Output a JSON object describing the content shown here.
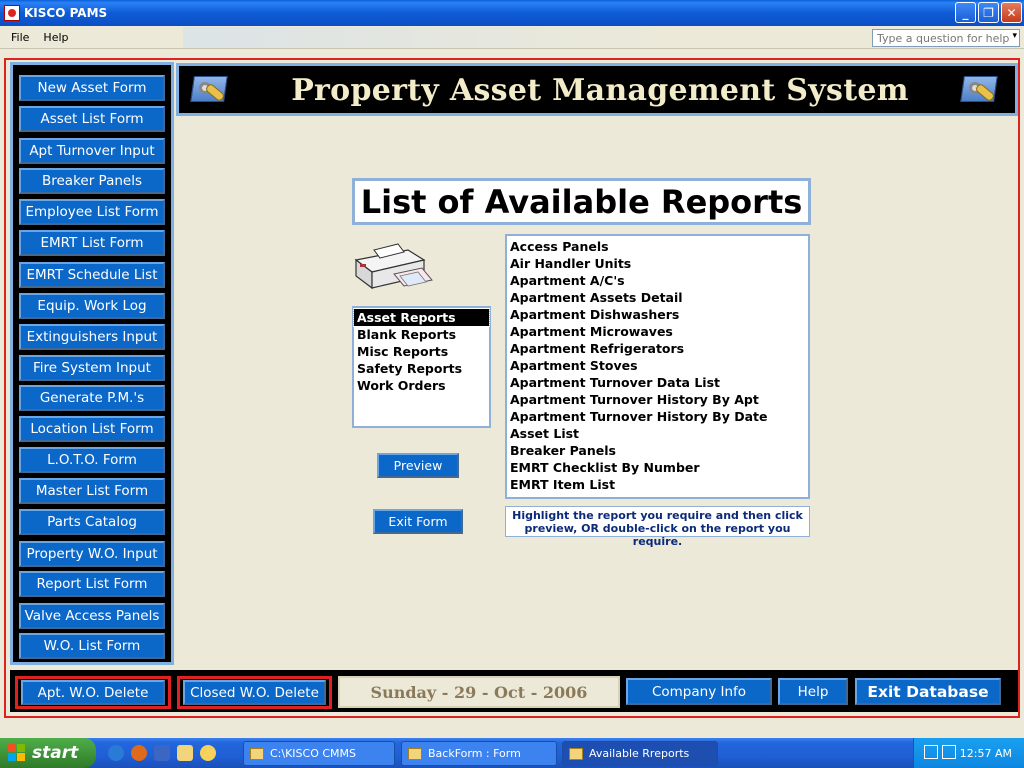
{
  "window": {
    "title": "KISCO PAMS",
    "minimize": "_",
    "restore": "❐",
    "close": "✕"
  },
  "menu": {
    "items": [
      "File",
      "Help"
    ],
    "help_placeholder": "Type a question for help"
  },
  "header": {
    "title": "Property Asset Management System"
  },
  "sidebar": {
    "buttons": [
      "New Asset Form",
      "Asset List Form",
      "Apt Turnover Input",
      "Breaker Panels",
      "Employee List Form",
      "EMRT List Form",
      "EMRT Schedule List",
      "Equip. Work Log",
      "Extinguishers Input",
      "Fire System Input",
      "Generate P.M.'s",
      "Location List Form",
      "L.O.T.O. Form",
      "Master List Form",
      "Parts Catalog",
      "Property W.O. Input",
      "Report List Form",
      "Valve Access Panels",
      "W.O. List Form"
    ]
  },
  "reports": {
    "title": "List of Available Reports",
    "categories": [
      "Asset Reports",
      "Blank Reports",
      "Misc Reports",
      "Safety Reports",
      "Work Orders"
    ],
    "selected_category": "Asset Reports",
    "items": [
      "Access Panels",
      "Air Handler Units",
      "Apartment A/C's",
      "Apartment Assets Detail",
      "Apartment Dishwashers",
      "Apartment Microwaves",
      "Apartment Refrigerators",
      "Apartment Stoves",
      "Apartment Turnover Data List",
      "Apartment Turnover History By Apt",
      "Apartment Turnover History By Date",
      "Asset List",
      "Breaker Panels",
      "EMRT Checklist By Number",
      "EMRT Item List"
    ],
    "preview_label": "Preview",
    "exit_label": "Exit Form",
    "hint": "Highlight the report you require and then click preview, OR double-click on the report you require."
  },
  "bottom": {
    "apt_delete": "Apt. W.O. Delete",
    "closed_delete": "Closed W.O. Delete",
    "date": "Sunday - 29 - Oct - 2006",
    "company_info": "Company Info",
    "help": "Help",
    "exit_db": "Exit Database"
  },
  "taskbar": {
    "start": "start",
    "tasks": [
      "C:\\KISCO CMMS",
      "BackForm : Form",
      "Available Rreports"
    ],
    "active_task": "Available Rreports",
    "clock": "12:57 AM"
  },
  "colors": {
    "accent_blue": "#0b67c8",
    "frame_red": "#dd2222",
    "header_text": "#f3ecc8"
  }
}
